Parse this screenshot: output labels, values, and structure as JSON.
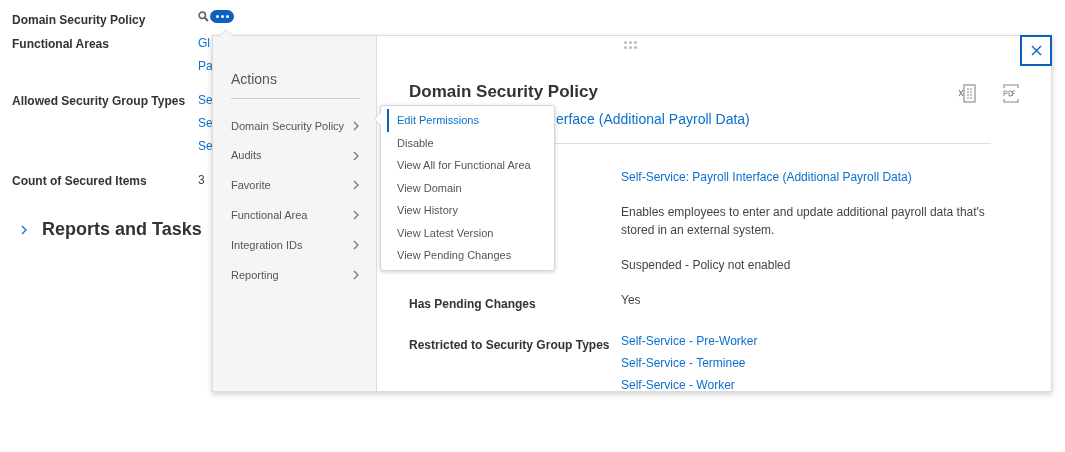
{
  "page": {
    "fields": [
      {
        "label": "Domain Security Policy",
        "kind": "header"
      },
      {
        "label": "Functional Areas",
        "kind": "values",
        "values": [
          {
            "text": "Gl",
            "kind": "link"
          },
          {
            "text": "Pa",
            "kind": "link"
          }
        ]
      },
      {
        "label": "Allowed Security Group Types",
        "kind": "values",
        "values": [
          {
            "text": "Se",
            "kind": "link"
          },
          {
            "text": "Se",
            "kind": "link"
          },
          {
            "text": "Se",
            "kind": "link"
          }
        ]
      },
      {
        "label": "Count of Secured Items",
        "kind": "values",
        "values": [
          {
            "text": "3",
            "kind": "text"
          }
        ]
      }
    ],
    "section": {
      "title": "Reports and Tasks",
      "expanded": false
    }
  },
  "popup": {
    "heading": "Actions",
    "menu": [
      {
        "label": "Domain Security Policy"
      },
      {
        "label": "Audits"
      },
      {
        "label": "Favorite"
      },
      {
        "label": "Functional Area"
      },
      {
        "label": "Integration IDs"
      },
      {
        "label": "Reporting"
      }
    ],
    "submenu": [
      {
        "label": "Edit Permissions",
        "selected": true
      },
      {
        "label": "Disable",
        "selected": false
      },
      {
        "label": "View All for Functional Area",
        "selected": false
      },
      {
        "label": "View Domain",
        "selected": false
      },
      {
        "label": "View History",
        "selected": false
      },
      {
        "label": "View Latest Version",
        "selected": false
      },
      {
        "label": "View Pending Changes",
        "selected": false
      }
    ],
    "detail": {
      "title": "Domain Security Policy",
      "subtitle": "erface (Additional Payroll Data)",
      "rows": [
        {
          "values": [
            {
              "text": "Self-Service: Payroll Interface (Additional Payroll Data)",
              "kind": "link"
            }
          ]
        },
        {
          "values": [
            {
              "text": "Enables employees to enter and update additional payroll data that's stored in an external system.",
              "kind": "text"
            }
          ]
        },
        {
          "values": [
            {
              "text": "Suspended - Policy not enabled",
              "kind": "text"
            }
          ]
        },
        {
          "label": "Has Pending Changes",
          "values": [
            {
              "text": "Yes",
              "kind": "text"
            }
          ]
        },
        {
          "label": "Restricted to Security Group Types",
          "values": [
            {
              "text": "Self-Service - Pre-Worker",
              "kind": "link"
            },
            {
              "text": "Self-Service - Terminee",
              "kind": "link"
            },
            {
              "text": "Self-Service - Worker",
              "kind": "link"
            }
          ]
        }
      ]
    }
  }
}
